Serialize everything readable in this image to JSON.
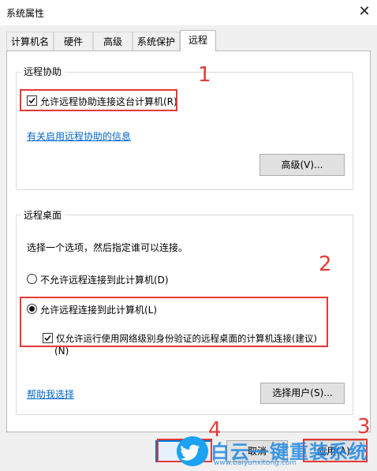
{
  "window": {
    "title": "系统属性"
  },
  "tabs": [
    "计算机名",
    "硬件",
    "高级",
    "系统保护",
    "远程"
  ],
  "remote_assistance": {
    "group_title": "远程协助",
    "allow_label": "允许远程协助连接这台计算机(R)",
    "info_link": "有关启用远程协助的信息",
    "advanced_button": "高级(V)..."
  },
  "remote_desktop": {
    "group_title": "远程桌面",
    "instruction": "选择一个选项，然后指定谁可以连接。",
    "option_disallow": "不允许远程连接到此计算机(D)",
    "option_allow": "允许远程连接到此计算机(L)",
    "nla_label_line1": "仅允许运行使用网络级别身份验证的远程桌面的计算机连接(建议)",
    "nla_label_line2": "(N)",
    "help_link": "帮助我选择",
    "select_users_button": "选择用户(S)..."
  },
  "footer": {
    "ok_button": "",
    "cancel_button": "取消",
    "apply_button": "应用(A)"
  },
  "annotations": {
    "n1": "1",
    "n2": "2",
    "n3": "3",
    "n4": "4"
  },
  "watermark": {
    "brand": "白云一键重装系统",
    "url": "www.baiyunxitong.com"
  },
  "colors": {
    "annotation_red": "#e53935",
    "link_blue": "#0066cc",
    "twitter_blue": "#1da1f2"
  }
}
